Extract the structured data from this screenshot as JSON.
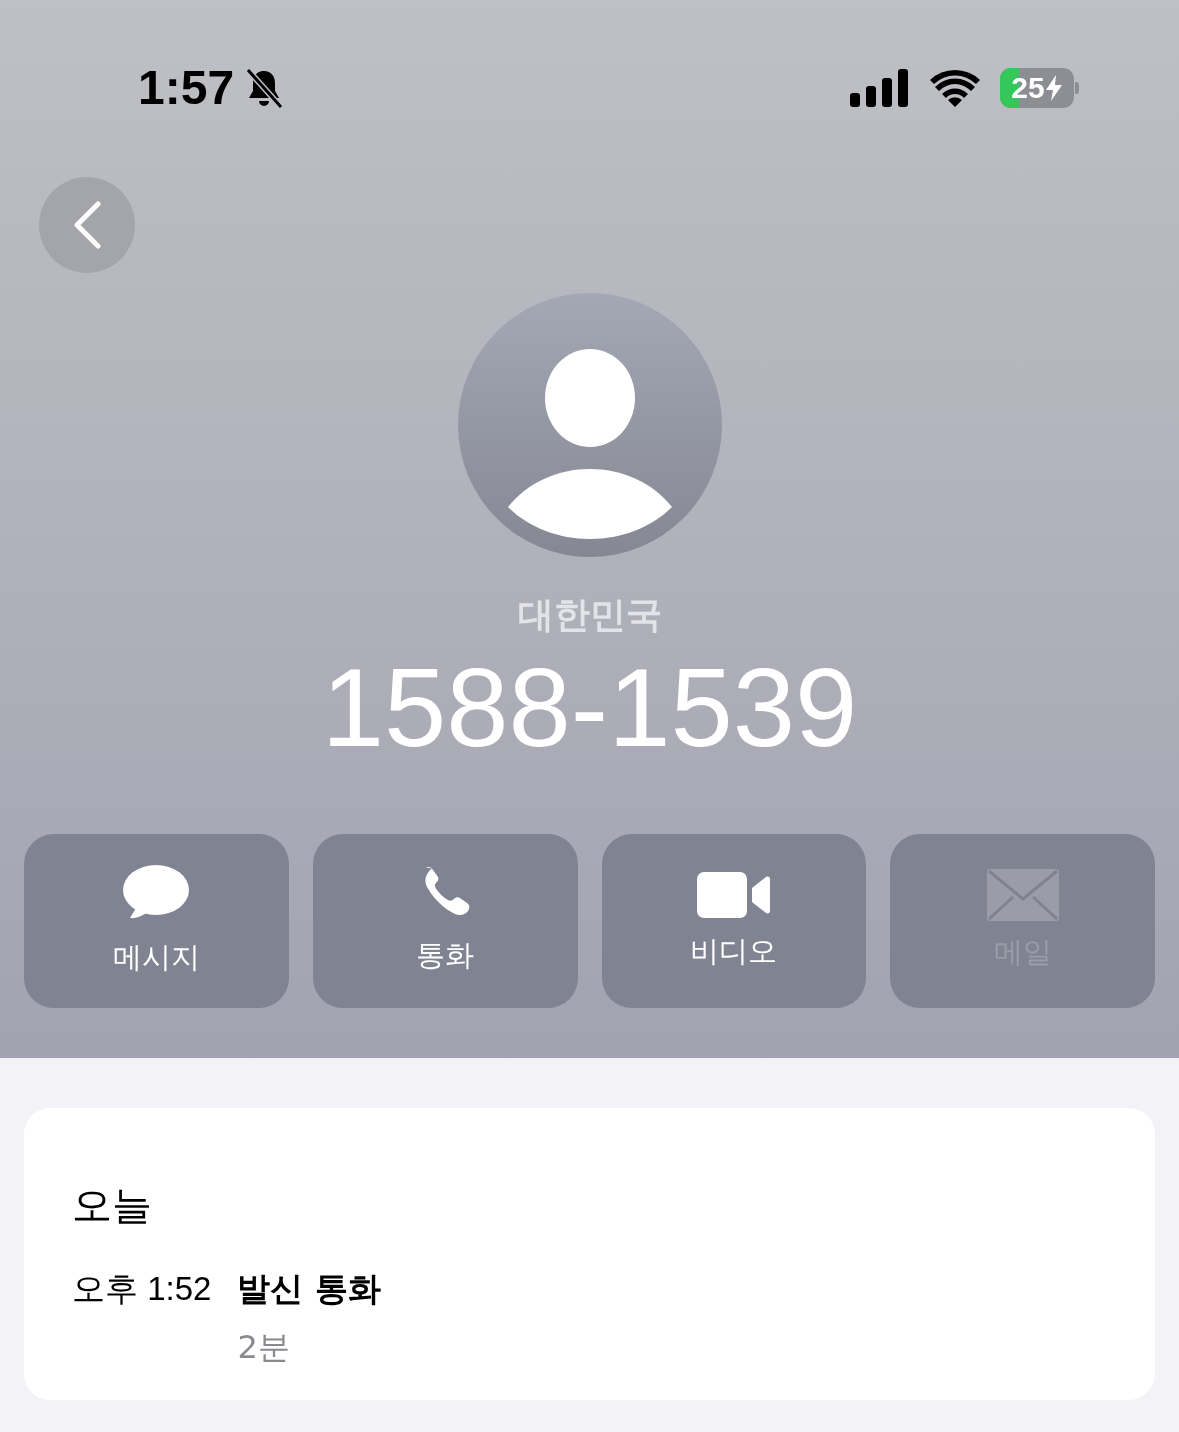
{
  "status_bar": {
    "time": "1:57",
    "silent": true,
    "battery": "25"
  },
  "contact": {
    "country": "대한민국",
    "number": "1588-1539"
  },
  "actions": [
    {
      "kind": "message",
      "label": "메시지",
      "disabled": false
    },
    {
      "kind": "call",
      "label": "통화",
      "disabled": false
    },
    {
      "kind": "video",
      "label": "비디오",
      "disabled": false
    },
    {
      "kind": "mail",
      "label": "메일",
      "disabled": true
    }
  ],
  "history": {
    "day": "오늘",
    "entries": [
      {
        "time": "오후 1:52",
        "type": "발신 통화",
        "duration": "2분"
      }
    ]
  }
}
